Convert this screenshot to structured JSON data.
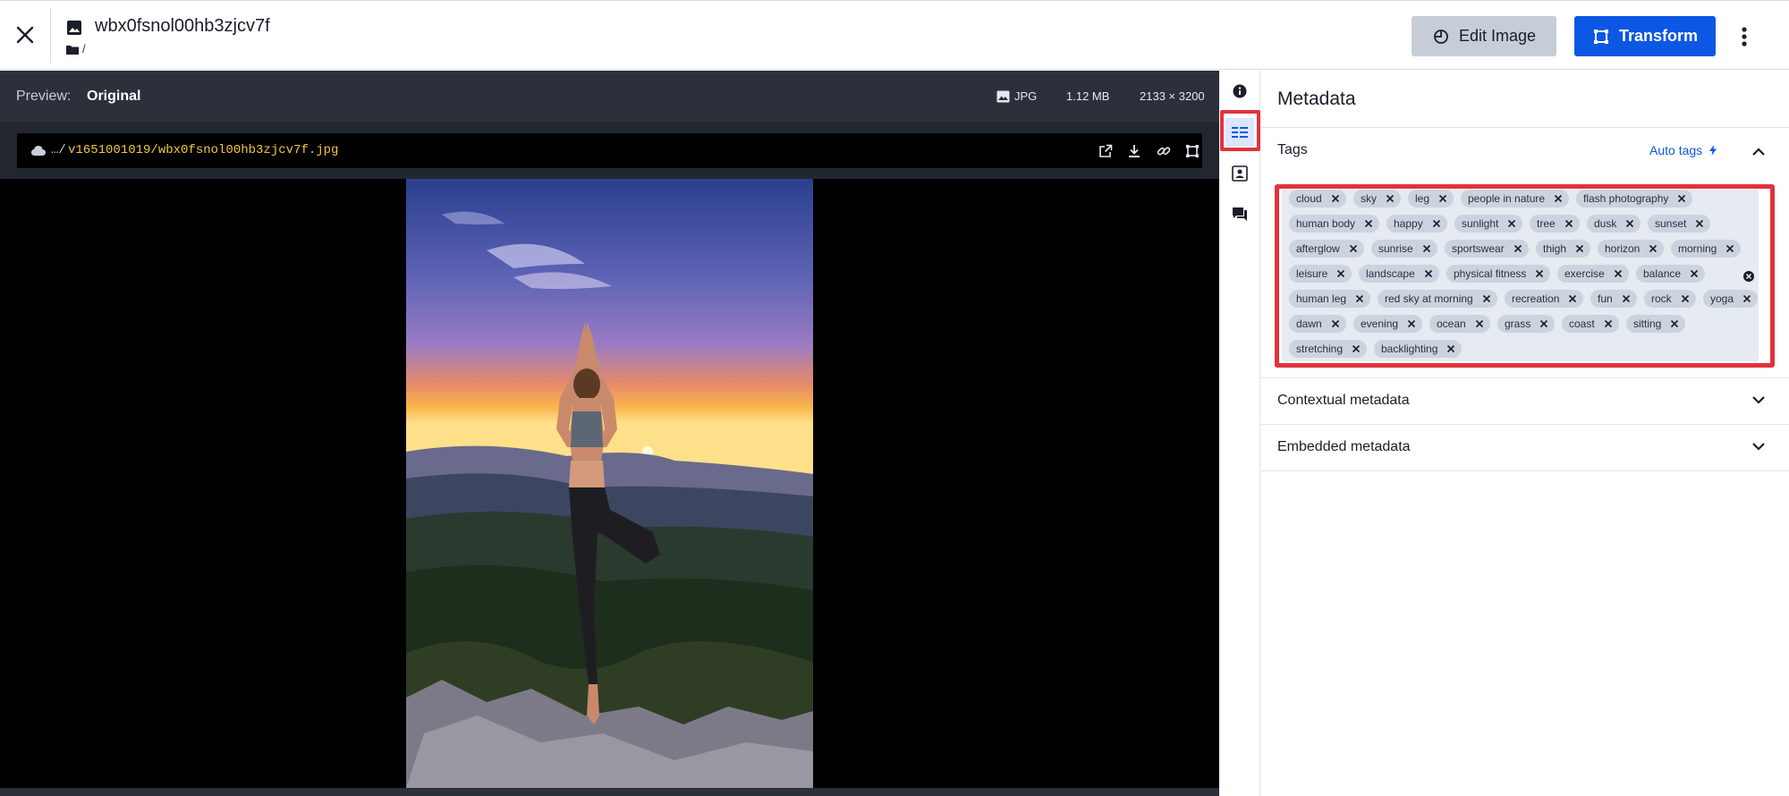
{
  "header": {
    "title": "wbx0fsnol00hb3zjcv7f",
    "folder_path": "/",
    "edit_label": "Edit Image",
    "transform_label": "Transform"
  },
  "preview": {
    "label": "Preview:",
    "value": "Original",
    "format": "JPG",
    "size": "1.12 MB",
    "dimensions": "2133 × 3200",
    "url_prefix": "…/",
    "url_path": "v1651001019/wbx0fsnol00hb3zjcv7f.jpg"
  },
  "panel": {
    "title": "Metadata",
    "tags_title": "Tags",
    "auto_tags_label": "Auto tags",
    "contextual_title": "Contextual metadata",
    "embedded_title": "Embedded metadata"
  },
  "tags": [
    [
      "cloud",
      "sky",
      "leg",
      "people in nature",
      "flash photography"
    ],
    [
      "human body",
      "happy",
      "sunlight",
      "tree",
      "dusk",
      "sunset"
    ],
    [
      "afterglow",
      "sunrise",
      "sportswear",
      "thigh",
      "horizon",
      "morning"
    ],
    [
      "leisure",
      "landscape",
      "physical fitness",
      "exercise",
      "balance"
    ],
    [
      "human leg",
      "red sky at morning",
      "recreation",
      "fun",
      "rock",
      "yoga"
    ],
    [
      "dawn",
      "evening",
      "ocean",
      "grass",
      "coast",
      "sitting"
    ],
    [
      "stretching",
      "backlighting"
    ]
  ],
  "colors": {
    "primary": "#0c57e4",
    "highlight": "#e2323d",
    "url_text": "#f4c542"
  }
}
